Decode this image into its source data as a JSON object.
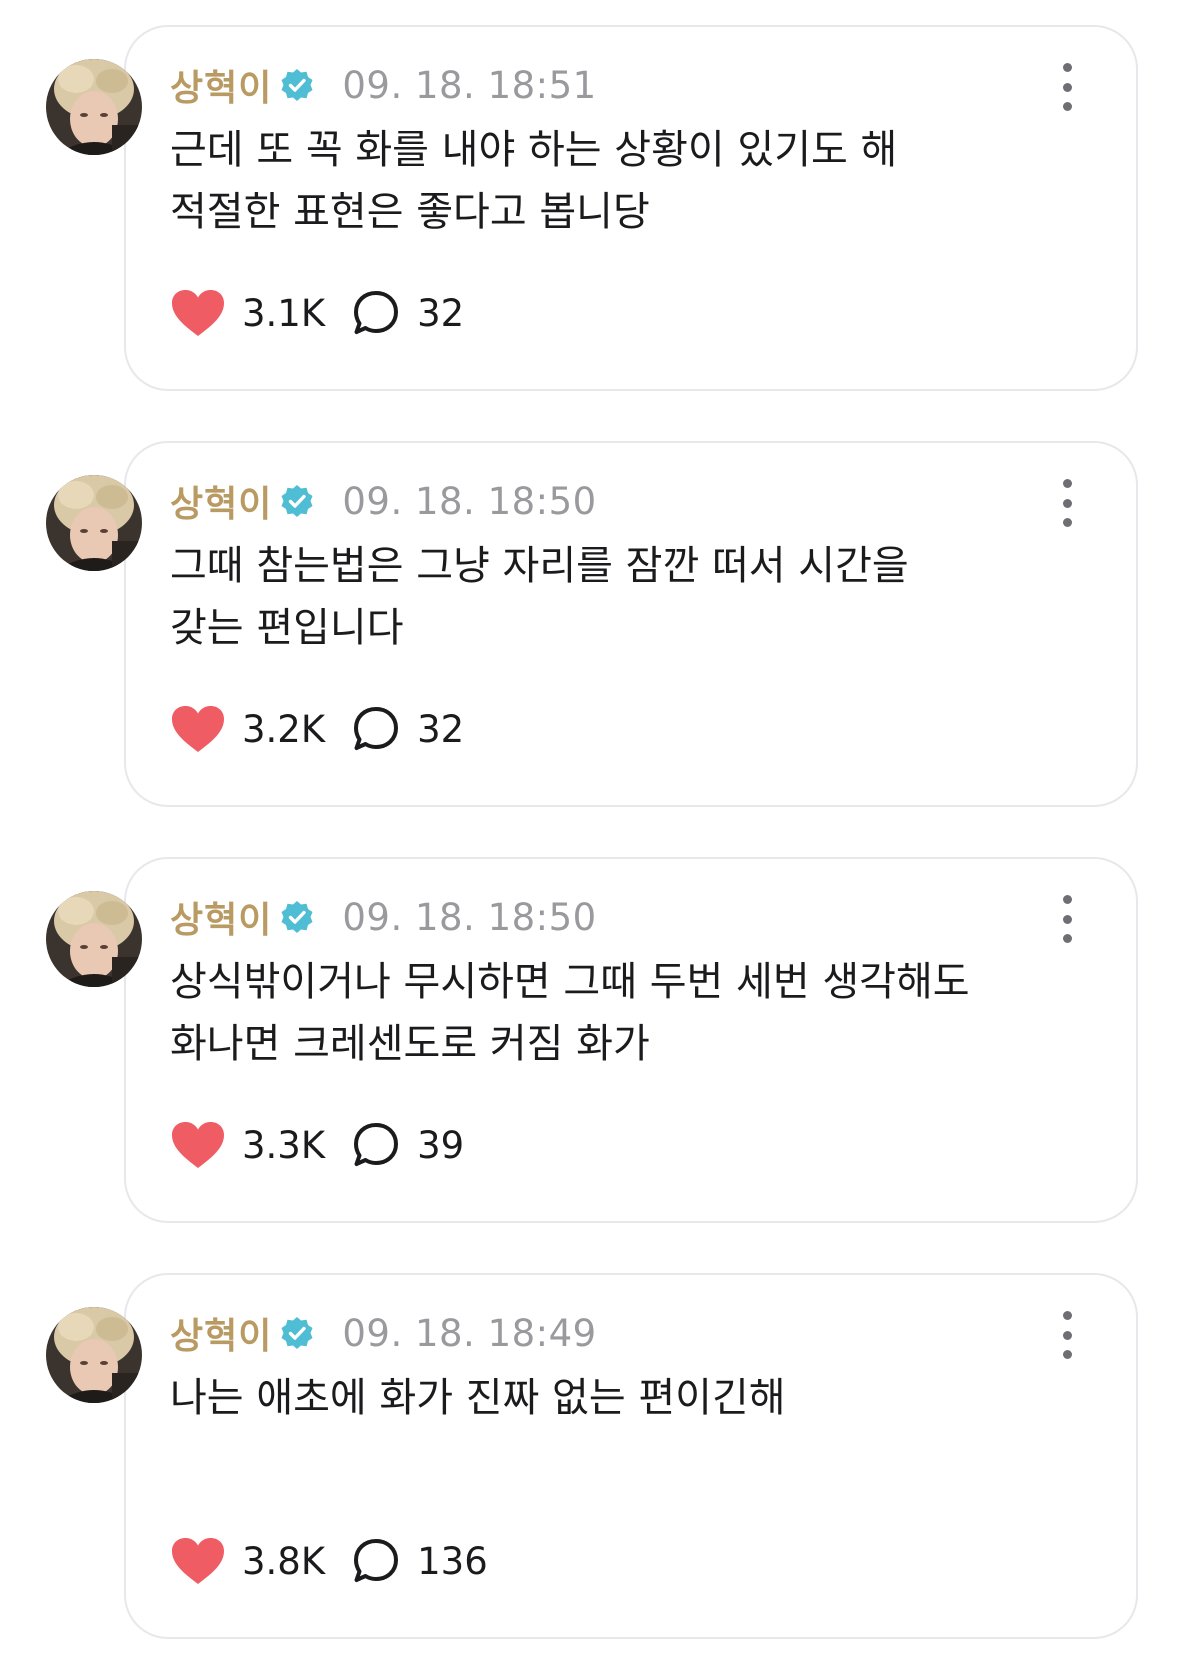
{
  "colors": {
    "username": "#b99a63",
    "verified": "#4fbdd3",
    "heart": "#ef5c63",
    "timestamp": "#9a9a9e",
    "text": "#1b1b1d",
    "card_border": "#e7e7ec"
  },
  "icons": {
    "verified": "verified-badge-icon",
    "like": "heart-icon",
    "comment": "speech-bubble-icon",
    "more": "more-vertical-icon"
  },
  "posts": [
    {
      "username": "상혁이",
      "timestamp": "09. 18. 18:51",
      "lines": [
        "근데 또 꼭 화를 내야 하는 상황이 있기도 해",
        "적절한 표현은 좋다고 봅니당"
      ],
      "likes": "3.1K",
      "comments": "32"
    },
    {
      "username": "상혁이",
      "timestamp": "09. 18. 18:50",
      "lines": [
        "그때 참는법은 그냥 자리를 잠깐 떠서 시간을",
        "갖는 편입니다"
      ],
      "likes": "3.2K",
      "comments": "32"
    },
    {
      "username": "상혁이",
      "timestamp": "09. 18. 18:50",
      "lines": [
        "상식밖이거나 무시하면 그때 두번 세번 생각해도",
        "화나면 크레센도로 커짐 화가"
      ],
      "likes": "3.3K",
      "comments": "39"
    },
    {
      "username": "상혁이",
      "timestamp": "09. 18. 18:49",
      "lines": [
        "나는 애초에 화가 진짜 없는 편이긴해"
      ],
      "likes": "3.8K",
      "comments": "136"
    }
  ]
}
